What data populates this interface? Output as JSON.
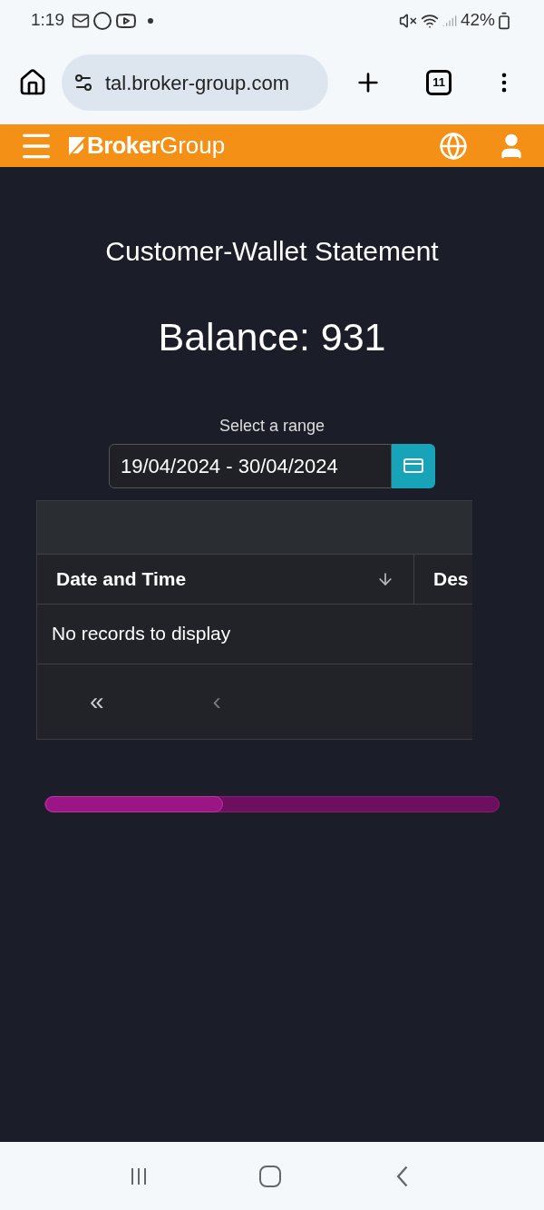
{
  "status_bar": {
    "time": "1:19",
    "battery": "42%"
  },
  "browser": {
    "url": "tal.broker-group.com",
    "tab_count": "11"
  },
  "header": {
    "logo_bold": "Broker",
    "logo_light": "Group"
  },
  "title": "Customer-Wallet Statement",
  "balance": "Balance: 931",
  "range": {
    "label": "Select a range",
    "value": "19/04/2024 - 30/04/2024"
  },
  "table": {
    "columns": [
      {
        "label": "Date and Time",
        "sorted": true
      },
      {
        "label": "Des"
      }
    ],
    "empty": "No records to display",
    "pager": [
      "«",
      "‹"
    ]
  }
}
